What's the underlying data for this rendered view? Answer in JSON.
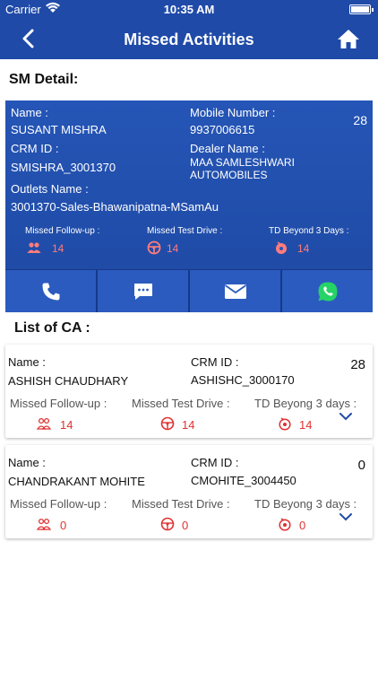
{
  "status_bar": {
    "carrier": "Carrier",
    "time": "10:35 AM"
  },
  "nav": {
    "title": "Missed Activities"
  },
  "sm_detail": {
    "section_title": "SM Detail:",
    "count": "28",
    "name_label": "Name :",
    "name": "SUSANT MISHRA",
    "mobile_label": "Mobile Number :",
    "mobile": "9937006615",
    "crm_label": "CRM ID :",
    "crm": "SMISHRA_3001370",
    "dealer_label": "Dealer Name :",
    "dealer_line1": "MAA SAMLESHWARI",
    "dealer_line2": "AUTOMOBILES",
    "outlets_label": "Outlets Name :",
    "outlets": "3001370-Sales-Bhawanipatna-MSamAu",
    "missed_followup_label": "Missed Follow-up :",
    "missed_followup": "14",
    "missed_testdrive_label": "Missed Test Drive :",
    "missed_testdrive": "14",
    "td_beyond_label": "TD Beyond 3 Days :",
    "td_beyond": "14"
  },
  "list": {
    "title": "List of CA :",
    "items": [
      {
        "count": "28",
        "name_label": "Name :",
        "name": "ASHISH CHAUDHARY",
        "crm_label": "CRM ID :",
        "crm": "ASHISHC_3000170",
        "missed_followup_label": "Missed Follow-up :",
        "missed_followup": "14",
        "missed_testdrive_label": "Missed Test Drive :",
        "missed_testdrive": "14",
        "td_beyond_label": "TD Beyong 3 days :",
        "td_beyond": "14"
      },
      {
        "count": "0",
        "name_label": "Name :",
        "name": "CHANDRAKANT MOHITE",
        "crm_label": "CRM ID :",
        "crm": "CMOHITE_3004450",
        "missed_followup_label": "Missed Follow-up :",
        "missed_followup": "0",
        "missed_testdrive_label": "Missed Test Drive :",
        "missed_testdrive": "0",
        "td_beyond_label": "TD Beyong 3 days :",
        "td_beyond": "0"
      }
    ]
  },
  "colors": {
    "primary": "#1f4aa8",
    "missed_red": "#e03131",
    "whatsapp": "#25d366"
  },
  "icons": [
    "back-arrow-icon",
    "home-icon",
    "phone-icon",
    "sms-icon",
    "email-icon",
    "whatsapp-icon",
    "followup-icon",
    "steering-wheel-icon",
    "td-icon",
    "chevron-down-icon"
  ]
}
